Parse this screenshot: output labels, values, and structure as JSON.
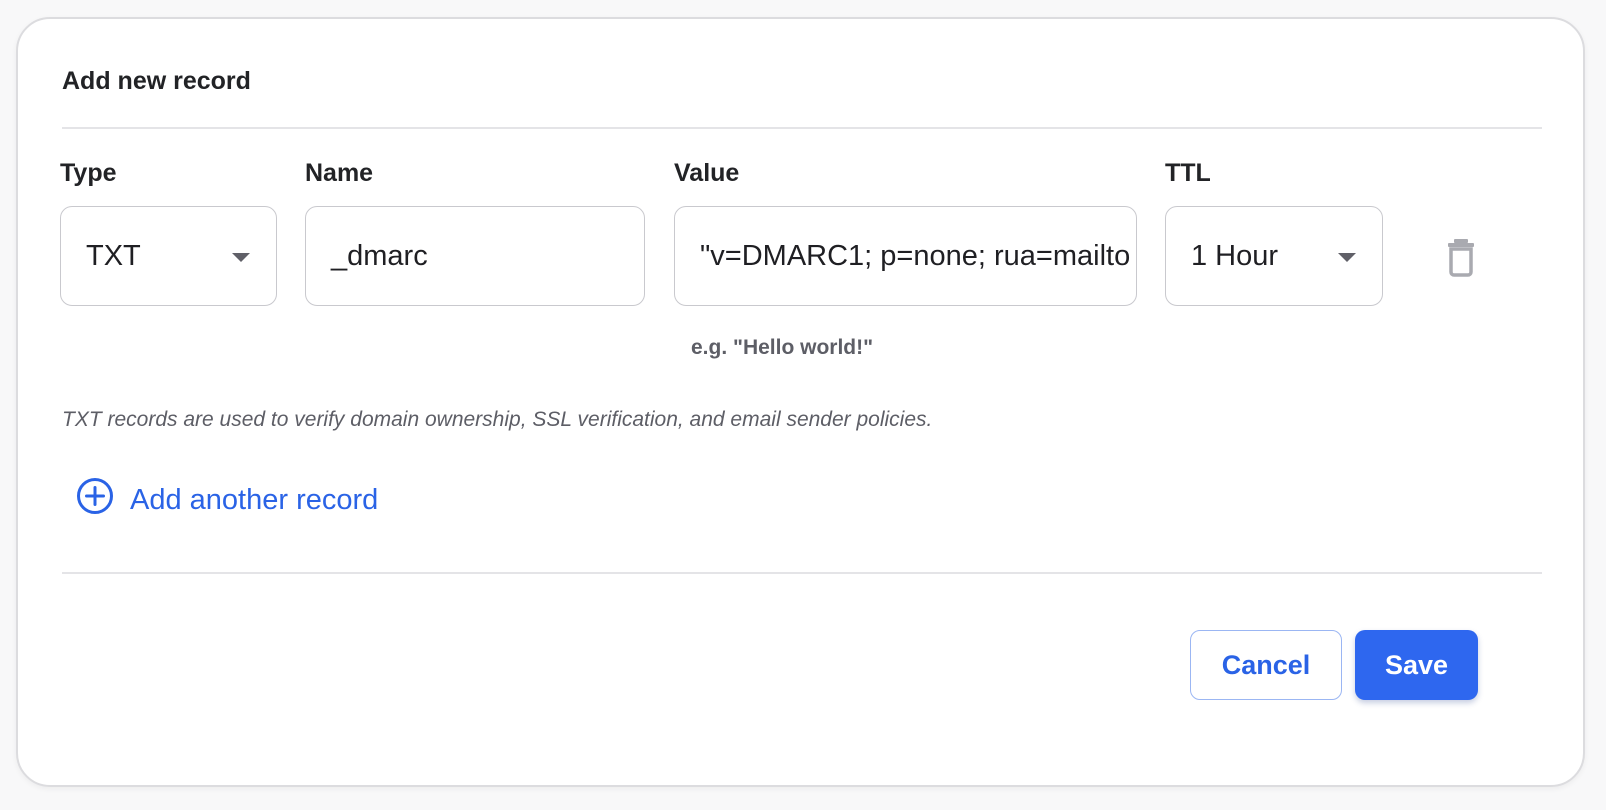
{
  "dialog": {
    "title": "Add new record",
    "description": "TXT records are used to verify domain ownership, SSL verification, and email sender policies.",
    "add_another_label": "Add another record"
  },
  "record": {
    "type_label": "Type",
    "type_value": "TXT",
    "name_label": "Name",
    "name_value": "_dmarc",
    "value_label": "Value",
    "value_value": "\"v=DMARC1; p=none; rua=mailto",
    "value_hint": "e.g. \"Hello world!\"",
    "ttl_label": "TTL",
    "ttl_value": "1 Hour"
  },
  "icons": {
    "type_dropdown": "chevron-down-icon",
    "ttl_dropdown": "chevron-down-icon",
    "delete": "trash-icon",
    "add": "plus-circle-icon"
  },
  "actions": {
    "cancel_label": "Cancel",
    "save_label": "Save"
  },
  "colors": {
    "accent": "#2e67ef",
    "link": "#2a63e6",
    "muted_text": "#5d5e66",
    "icon_gray": "#a9aab0"
  }
}
